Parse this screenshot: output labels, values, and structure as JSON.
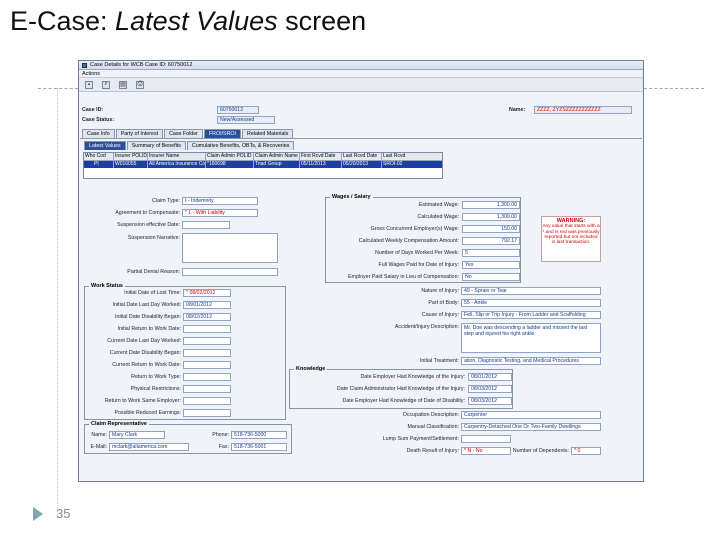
{
  "slide": {
    "title_plain_1": "E-Case: ",
    "title_italic": "Latest Values",
    "title_plain_2": " screen",
    "page_number": "35"
  },
  "window": {
    "title": "Case Details for WCB Case ID: 60750012",
    "menu": "Actions"
  },
  "case": {
    "id_label": "Case ID:",
    "id_value": "60750012",
    "status_label": "Case Status:",
    "status_value": "New/Assessed",
    "name_label": "Name:",
    "name_value": "ZZZZ, ZYZSZZZZZZZZZZZ"
  },
  "main_tabs": [
    "Case Info",
    "Party of Interest",
    "Case Folder",
    "FROI/SROI",
    "Related Materials"
  ],
  "sub_tabs": [
    "Latest Values",
    "Summary of Benefits",
    "Cumulative Benefits, OBTs, & Recoveries"
  ],
  "grid": {
    "headers": [
      "Who Cod",
      "Insurer POLID",
      "Insurer Name",
      "Claim Admin POLID",
      "Claim Admin Name",
      "First Rcvd Date",
      "Last Rcvd Date",
      "Last Rcvd"
    ],
    "row": [
      "PI",
      "W016055",
      "All America Insurance Co",
      "*160698",
      "Triad Group",
      "05/11/2013",
      "05/20/2013",
      "SROI-02"
    ]
  },
  "claim": {
    "claim_type_label": "Claim Type:",
    "claim_type_value": "I - Indemnity",
    "agreement_label": "Agreement to Compensate:",
    "agreement_value": "* L - With Liability",
    "suspension_date_label": "Suspension effective Date:",
    "suspension_narr_label": "Suspension Narrative:",
    "partial_denial_label": "Partial Denial Reason:"
  },
  "wages": {
    "title": "Wages / Salary",
    "rows": [
      {
        "label": "Estimated Wage:",
        "value": "1,300.00"
      },
      {
        "label": "Calculated Wage:",
        "value": "1,300.00"
      },
      {
        "label": "Gross Concurrent Employer(s) Wage:",
        "value": "150.00"
      },
      {
        "label": "Calculated Weekly Compensation Amount:",
        "value": "792.17"
      },
      {
        "label": "Number of Days Worked Per Week:",
        "value": "5"
      },
      {
        "label": "Full Wages Paid for Date of Injury:",
        "value": "Yes"
      },
      {
        "label": "Employer Paid Salary in Lieu of Compensation:",
        "value": "No"
      }
    ]
  },
  "warning": {
    "title": "WARNING:",
    "text": "Any value that starts with a * and is red was previously reported but not included in last transaction."
  },
  "work_status": {
    "title": "Work Status",
    "rows": [
      {
        "label": "Initial Date of Lost Time:",
        "value": "* 08/02/2012"
      },
      {
        "label": "Initial Date Last Day Worked:",
        "value": "08/01/2012"
      },
      {
        "label": "Initial Date Disability Began:",
        "value": "08/02/2012"
      },
      {
        "label": "Initial Return to Work Date:",
        "value": ""
      },
      {
        "label": "Current Date Last Day Worked:",
        "value": ""
      },
      {
        "label": "Current Date Disability Began:",
        "value": ""
      },
      {
        "label": "Current Return to Work Date:",
        "value": ""
      },
      {
        "label": "Return to Work Type:",
        "value": ""
      },
      {
        "label": "Physical Restrictions:",
        "value": ""
      },
      {
        "label": "Return to Work Same Employer:",
        "value": ""
      },
      {
        "label": "Possible Reduced Earnings:",
        "value": ""
      }
    ]
  },
  "injury": {
    "nature_label": "Nature of Injury:",
    "nature_value": "49 - Sprain or Tear",
    "body_label": "Part of Body:",
    "body_value": "55 - Ankle",
    "cause_label": "Cause of Injury:",
    "cause_value": "Fell, Slip or Trip Injury - From Ladder and Scaffolding",
    "desc_label": "Accident/Injury Description:",
    "desc_value": "Mr. Doe was descending a ladder and missed the last step and injured his right ankle",
    "treatment_label": "Initial Treatment:",
    "treatment_value": "ation, Diagnostic Testing, and Medical Procedures"
  },
  "knowledge": {
    "title": "Knowledge",
    "rows": [
      {
        "label": "Date Employer Had Knowledge of the Injury:",
        "value": "08/01/2012"
      },
      {
        "label": "Date Claim Administrator Had Knowledge of the Injury:",
        "value": "08/03/2012"
      },
      {
        "label": "Date Employer Had Knowledge of Date of Disability:",
        "value": "08/03/2012"
      }
    ]
  },
  "occupation": {
    "occ_label": "Occupation Description:",
    "occ_value": "Carpenter",
    "manual_label": "Manual Classification:",
    "manual_value": "Carpentry-Detached One Or Two-Family Dwellings",
    "lump_label": "Lump Sum Payment/Settlement:",
    "death_label": "Death Result of Injury:",
    "death_value": "* N - No",
    "dependents_label": "Number of Dependents:",
    "dependents_value": "* 0"
  },
  "rep": {
    "title": "Claim Representative",
    "name_label": "Name:",
    "name_value": "Mary Clark",
    "email_label": "E-Mail:",
    "email_value": "mclark@allamerica.com",
    "phone_label": "Phone:",
    "phone_value": "518-736-5000",
    "fax_label": "Fax:",
    "fax_value": "518-736-5001"
  }
}
